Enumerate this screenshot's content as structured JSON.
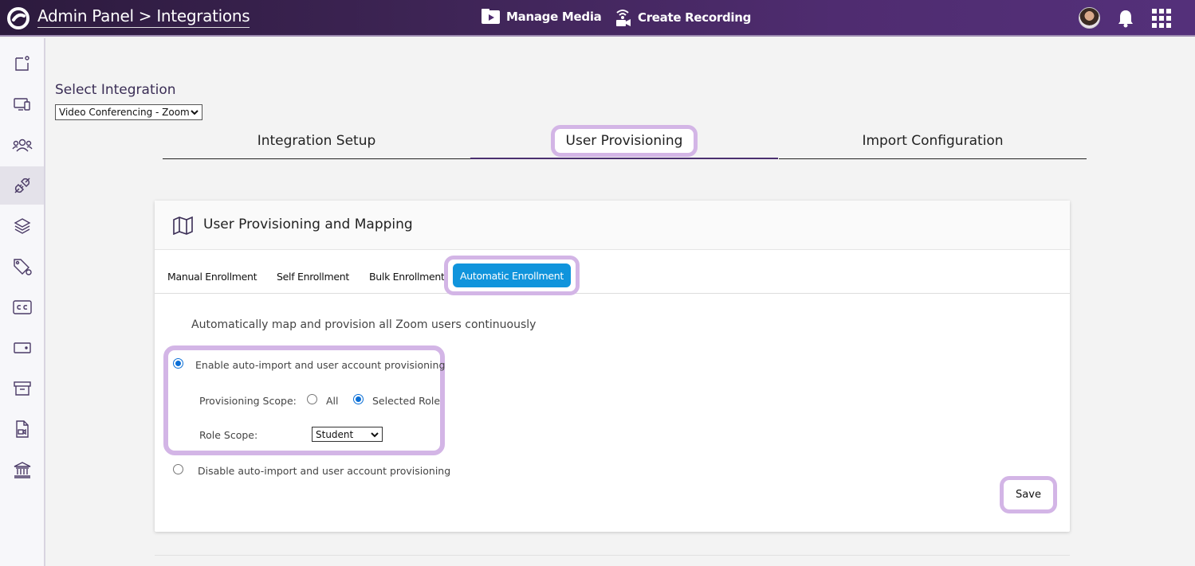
{
  "header": {
    "title": "Admin Panel > Integrations",
    "manage_media": "Manage Media",
    "create_recording": "Create Recording"
  },
  "sidebar": {
    "items": [
      {
        "icon": "page-icon"
      },
      {
        "icon": "devices-icon"
      },
      {
        "icon": "users-icon"
      },
      {
        "icon": "integrations-plug-icon",
        "active": true
      },
      {
        "icon": "layers-icon"
      },
      {
        "icon": "tag-icon"
      },
      {
        "icon": "captions-icon"
      },
      {
        "icon": "card-icon"
      },
      {
        "icon": "archive-icon"
      },
      {
        "icon": "file-video-icon"
      },
      {
        "icon": "institution-icon"
      }
    ]
  },
  "integration": {
    "label": "Select Integration",
    "selected": "Video Conferencing - Zoom"
  },
  "tabs": {
    "setup": "Integration Setup",
    "provisioning": "User Provisioning",
    "import": "Import Configuration"
  },
  "card": {
    "title": "User Provisioning and Mapping",
    "subtabs": {
      "manual": "Manual Enrollment",
      "self": "Self Enrollment",
      "bulk": "Bulk Enrollment",
      "automatic": "Automatic Enrollment"
    },
    "description": "Automatically map and provision all Zoom users continuously",
    "enable_label": "Enable auto-import and user account provisioning",
    "scope_label": "Provisioning Scope:",
    "scope_all": "All",
    "scope_selected_role": "Selected Role",
    "role_scope_label": "Role Scope:",
    "role_scope_value": "Student",
    "disable_label": "Disable auto-import and user account provisioning",
    "save_label": "Save"
  },
  "colors": {
    "accent": "#1094dc",
    "highlight": "#d3b5e6",
    "topbar": "#4f2c70"
  }
}
